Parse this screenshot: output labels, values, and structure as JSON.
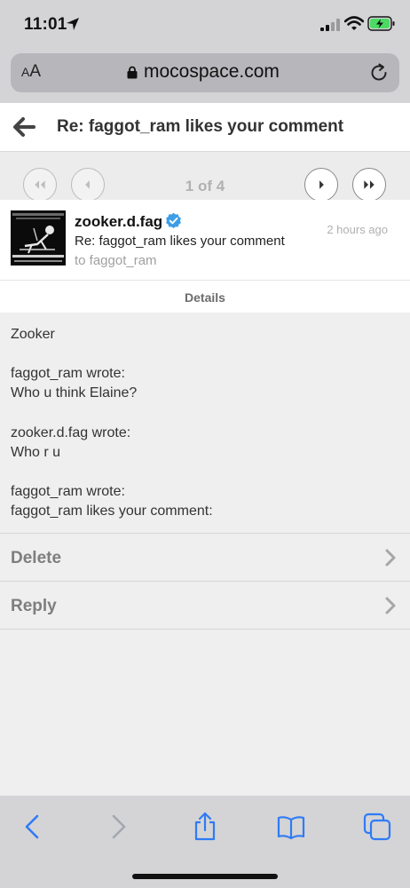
{
  "status_bar": {
    "time": "11:01",
    "icons": [
      "location-icon",
      "signal-icon",
      "wifi-icon",
      "battery-charging-icon"
    ]
  },
  "browser": {
    "text_size_label_small": "A",
    "text_size_label_large": "A",
    "url": "mocospace.com",
    "toolbar_icons": [
      "back-icon",
      "forward-icon",
      "share-icon",
      "bookmarks-icon",
      "tabs-icon"
    ],
    "accent_color": "#2f7bf5"
  },
  "header": {
    "title": "Re: faggot_ram likes your comment"
  },
  "pager": {
    "count_label": "1 of 4"
  },
  "message": {
    "sender": "zooker.d.fag",
    "time": "2 hours ago",
    "subject": "Re: faggot_ram likes your comment",
    "recipient": "to faggot_ram",
    "avatar_text_top": "MY ACT YOU FUCK OPEN IT",
    "avatar_text_bottom": "OK, AND HERE'S A STRAW"
  },
  "details": {
    "label": "Details"
  },
  "body_lines": [
    "Zooker",
    "faggot_ram wrote:",
    "Who u think Elaine?",
    "zooker.d.fag wrote:",
    "Who r u",
    "faggot_ram wrote:",
    "faggot_ram likes your comment:"
  ],
  "actions": {
    "delete_label": "Delete",
    "reply_label": "Reply"
  }
}
